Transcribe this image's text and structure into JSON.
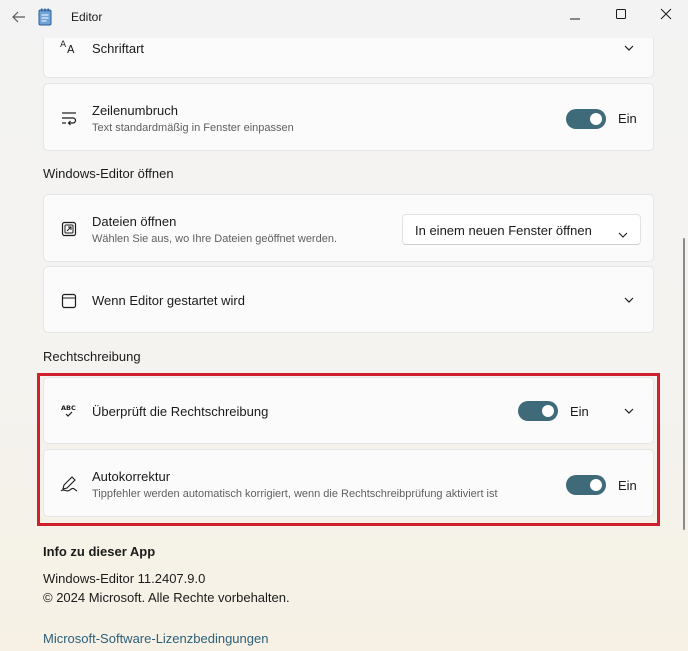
{
  "window": {
    "title": "Editor",
    "controls": {
      "minimize": "minimize-icon",
      "maximize": "maximize-icon",
      "close": "close-icon"
    }
  },
  "settings": {
    "font": {
      "title": "Schriftart",
      "icon": "font-icon"
    },
    "wordwrap": {
      "title": "Zeilenumbruch",
      "subtitle": "Text standardmäßig in Fenster einpassen",
      "toggle_label": "Ein",
      "toggle_on": true,
      "icon": "word-wrap-icon"
    },
    "open_section": {
      "header": "Windows-Editor öffnen",
      "open_files": {
        "title": "Dateien öffnen",
        "subtitle": "Wählen Sie aus, wo Ihre Dateien geöffnet werden.",
        "selected": "In einem neuen Fenster öffnen",
        "icon": "open-in-new-window-icon"
      },
      "on_start": {
        "title": "Wenn Editor gestartet wird",
        "icon": "window-icon"
      }
    },
    "spelling_section": {
      "header": "Rechtschreibung",
      "spellcheck": {
        "title": "Überprüft die Rechtschreibung",
        "toggle_label": "Ein",
        "toggle_on": true,
        "icon": "spellcheck-icon"
      },
      "autocorrect": {
        "title": "Autokorrektur",
        "subtitle": "Tippfehler werden automatisch korrigiert, wenn die Rechtschreibprüfung aktiviert ist",
        "toggle_label": "Ein",
        "toggle_on": true,
        "icon": "autocorrect-pen-icon"
      }
    }
  },
  "about": {
    "title": "Info zu dieser App",
    "version": "Windows-Editor 11.2407.9.0",
    "copyright": "© 2024 Microsoft. Alle Rechte vorbehalten.",
    "license_link": "Microsoft-Software-Lizenzbedingungen"
  },
  "colors": {
    "accent": "#3f6a79",
    "highlight": "#d0202e",
    "link": "#2c5f7a"
  }
}
